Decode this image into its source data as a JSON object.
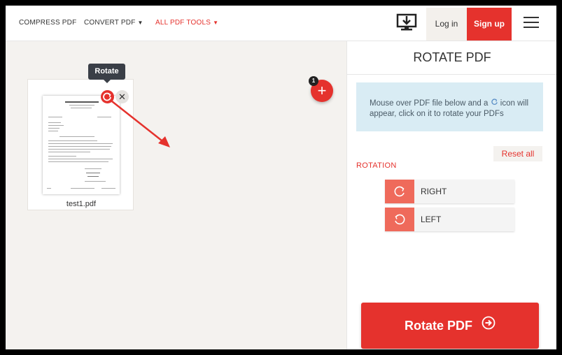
{
  "nav": {
    "compress_label": "COMPRESS PDF",
    "convert_label": "CONVERT PDF",
    "all_tools_label": "ALL PDF TOOLS",
    "login_label": "Log in",
    "signup_label": "Sign up"
  },
  "workspace": {
    "tooltip": "Rotate",
    "file_name": "test1.pdf",
    "add_badge": "1",
    "close_glyph": "✕",
    "add_glyph": "+"
  },
  "sidebar": {
    "title": "ROTATE PDF",
    "info_part1": "Mouse over PDF file below and a",
    "info_part2": "icon will appear, click on it to rotate your PDFs",
    "reset_label": "Reset all",
    "rotation_label": "ROTATION",
    "right_label": "RIGHT",
    "left_label": "LEFT",
    "submit_label": "Rotate PDF"
  },
  "colors": {
    "accent": "#e5322d",
    "light_accent": "#ef6a5b",
    "info_bg": "#d9ecf4",
    "workspace_bg": "#f4f2ef"
  },
  "icons": [
    "desktop-download-icon",
    "hamburger-menu-icon",
    "rotate-icon",
    "close-icon",
    "plus-icon",
    "rotate-right-icon",
    "rotate-left-icon",
    "arrow-right-circle-icon"
  ]
}
